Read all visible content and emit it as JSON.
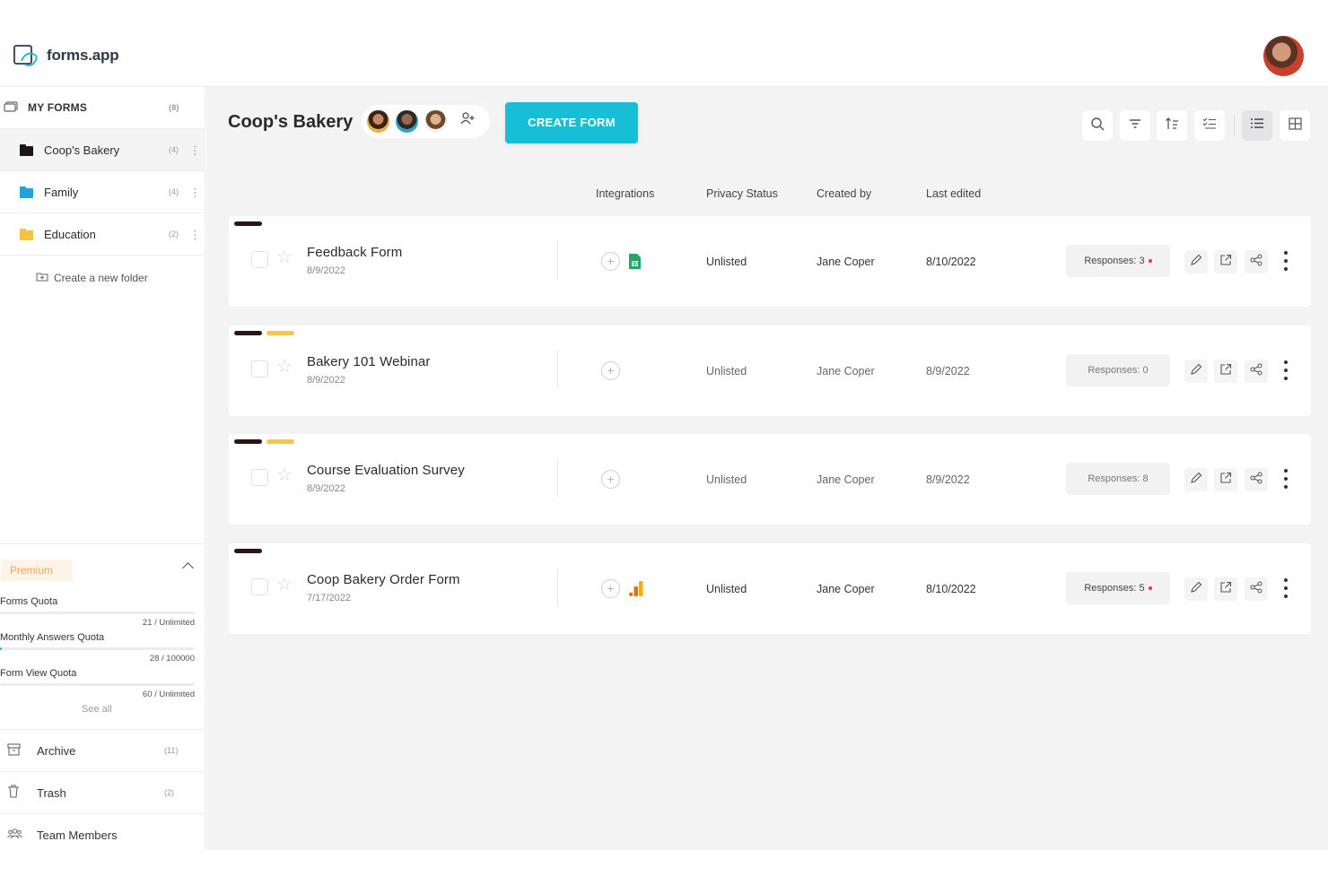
{
  "app": {
    "name": "forms.app"
  },
  "sidebar": {
    "my_forms": {
      "label": "MY FORMS",
      "count": "(8)"
    },
    "folders": [
      {
        "label": "Coop's Bakery",
        "count": "(4)",
        "color": "#1f1418",
        "active": true
      },
      {
        "label": "Family",
        "count": "(4)",
        "color": "#1fa3e0",
        "active": false
      },
      {
        "label": "Education",
        "count": "(2)",
        "color": "#f5c43c",
        "active": false
      }
    ],
    "create_folder": "Create a new folder",
    "premium": {
      "label": "Premium",
      "quotas": [
        {
          "label": "Forms Quota",
          "value": "21 / Unlimited",
          "fill": 0.0
        },
        {
          "label": "Monthly Answers Quota",
          "value": "28 / 100000",
          "fill": 0.01
        },
        {
          "label": "Form View Quota",
          "value": "60 / Unlimited",
          "fill": 0.0
        }
      ],
      "see_all": "See all"
    },
    "archive": {
      "label": "Archive",
      "count": "(11)"
    },
    "trash": {
      "label": "Trash",
      "count": "(2)"
    },
    "team": {
      "label": "Team Members"
    }
  },
  "main": {
    "title": "Coop's Bakery",
    "create_button": "CREATE FORM",
    "columns": {
      "integrations": "Integrations",
      "privacy": "Privacy Status",
      "created_by": "Created by",
      "last_edited": "Last edited"
    },
    "forms": [
      {
        "name": "Feedback Form",
        "date": "8/9/2022",
        "privacy": "Unlisted",
        "created_by": "Jane Coper",
        "last_edited": "8/10/2022",
        "responses": "Responses: 3",
        "has_new": true,
        "integration": "google-sheets-icon",
        "tags": [
          "#2a1518"
        ]
      },
      {
        "name": "Bakery 101 Webinar",
        "date": "8/9/2022",
        "privacy": "Unlisted",
        "created_by": "Jane Coper",
        "last_edited": "8/9/2022",
        "responses": "Responses: 0",
        "has_new": false,
        "integration": "",
        "tags": [
          "#2a1518",
          "#f7c846"
        ]
      },
      {
        "name": "Course Evaluation Survey",
        "date": "8/9/2022",
        "privacy": "Unlisted",
        "created_by": "Jane Coper",
        "last_edited": "8/9/2022",
        "responses": "Responses: 8",
        "has_new": false,
        "integration": "",
        "tags": [
          "#2a1518",
          "#f7c846"
        ]
      },
      {
        "name": "Coop Bakery Order Form",
        "date": "7/17/2022",
        "privacy": "Unlisted",
        "created_by": "Jane Coper",
        "last_edited": "8/10/2022",
        "responses": "Responses: 5",
        "has_new": true,
        "integration": "google-analytics-icon",
        "tags": [
          "#2a1518"
        ]
      }
    ]
  },
  "colors": {
    "accent": "#16bfd6",
    "premium": "#f3a457"
  }
}
